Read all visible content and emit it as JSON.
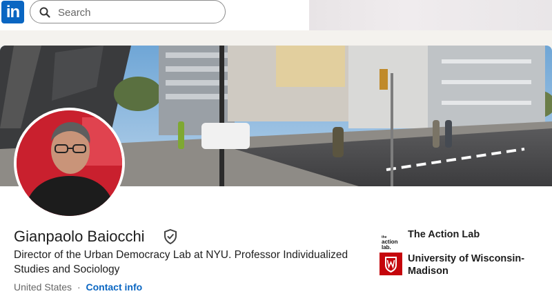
{
  "nav": {
    "logo_text": "in",
    "search_placeholder": "Search",
    "brand_color": "#0a66c2"
  },
  "profile": {
    "name": "Gianpaolo Baiocchi",
    "verified_icon": "shield-check-icon",
    "headline": "Director of the Urban Democracy Lab at NYU. Professor Individualized Studies and Sociology",
    "location": "United States",
    "separator": "·",
    "contact_info_label": "Contact info"
  },
  "organizations": [
    {
      "name": "The Action Lab",
      "logo_text": "the action lab",
      "logo": "action-lab-logo"
    },
    {
      "name": "University of Wisconsin-Madison",
      "logo": "uw-crest-logo",
      "accent": "#c5050c"
    }
  ]
}
